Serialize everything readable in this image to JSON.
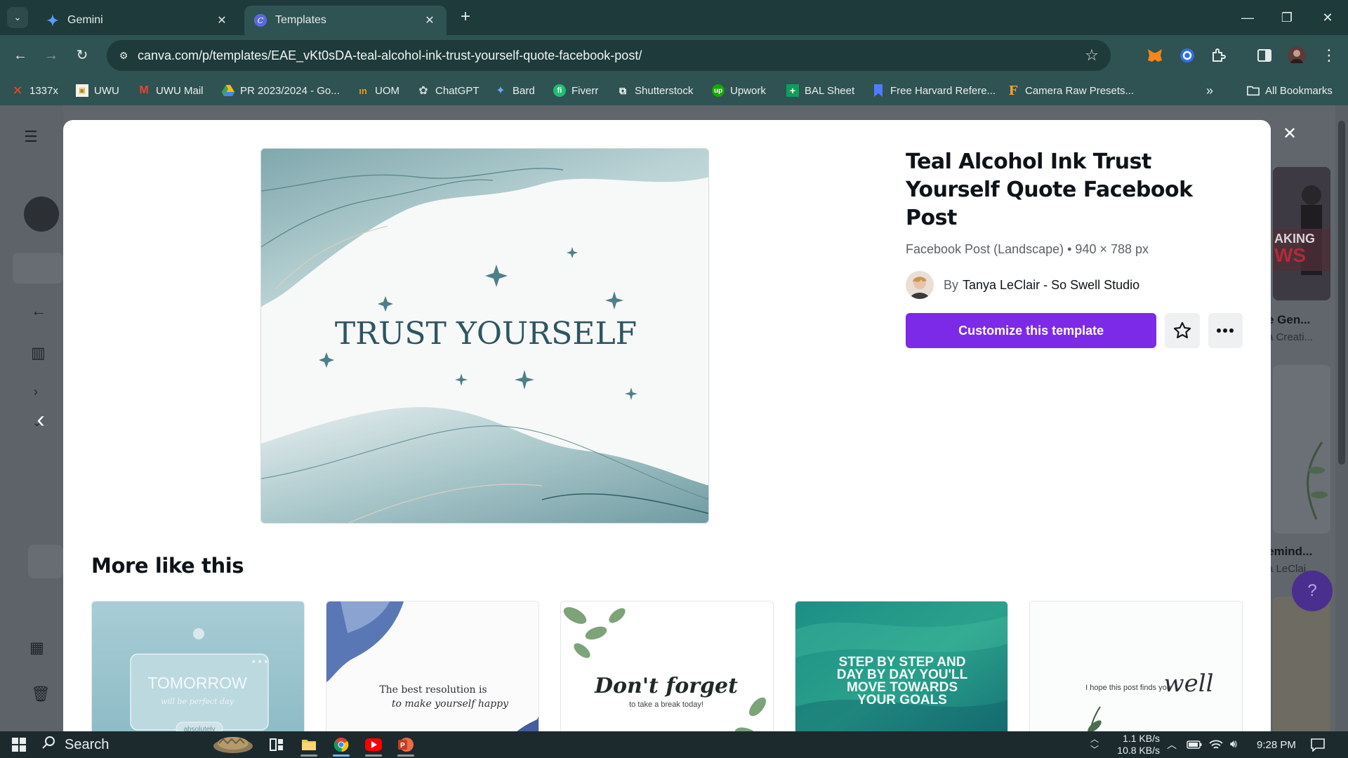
{
  "browser": {
    "tabs": [
      {
        "label": "Gemini",
        "icon": "gemini-sparkle-icon"
      },
      {
        "label": "Templates",
        "icon": "canva-logo-icon"
      }
    ],
    "url": "canva.com/p/templates/EAE_vKt0sDA-teal-alcohol-ink-trust-yourself-quote-facebook-post/",
    "bookmarks": [
      {
        "label": "1337x",
        "icon": "x-logo-icon",
        "color": "#e8492b"
      },
      {
        "label": "UWU",
        "icon": "uwu-crest-icon",
        "color": "#f1c40f"
      },
      {
        "label": "UWU Mail",
        "icon": "gmail-icon",
        "color": "#ea4335"
      },
      {
        "label": "PR 2023/2024 - Go...",
        "icon": "google-drive-icon",
        "color": "#34a853"
      },
      {
        "label": "UOM",
        "icon": "uom-logo-icon",
        "color": "#f39c12"
      },
      {
        "label": "ChatGPT",
        "icon": "chatgpt-icon",
        "color": "#c9d6d4"
      },
      {
        "label": "Bard",
        "icon": "bard-sparkle-icon",
        "color": "#6ea8fe"
      },
      {
        "label": "Fiverr",
        "icon": "fiverr-icon",
        "color": "#1dbf73"
      },
      {
        "label": "Shutterstock",
        "icon": "shutterstock-icon",
        "color": "#ffffff"
      },
      {
        "label": "Upwork",
        "icon": "upwork-icon",
        "color": "#14a800"
      },
      {
        "label": "BAL Sheet",
        "icon": "sheets-icon",
        "color": "#0f9d58"
      },
      {
        "label": "Free Harvard Refere...",
        "icon": "bookmark-icon",
        "color": "#4f7cff"
      },
      {
        "label": "Camera Raw Presets...",
        "icon": "f-logo-icon",
        "color": "#f5a623"
      }
    ],
    "all_bookmarks": "All Bookmarks"
  },
  "template": {
    "title": "Teal Alcohol Ink Trust Yourself Quote Facebook Post",
    "meta": "Facebook Post (Landscape) • 940 × 788 px",
    "by": "By",
    "author": "Tanya LeClair - So Swell Studio",
    "cta": "Customize this template",
    "preview_text": "TRUST YOURSELF"
  },
  "more": {
    "title": "More like this",
    "cards": [
      {
        "line1": "TOMORROW",
        "line2": "will be perfect day",
        "line3": "absolutely"
      },
      {
        "line1": "The best resolution is",
        "line2": "to make yourself happy"
      },
      {
        "line1": "Don't forget",
        "line2": "to take a break today!"
      },
      {
        "line1": "STEP BY STEP AND DAY BY DAY YOU'LL MOVE TOWARDS YOUR GOALS"
      },
      {
        "line1": "I hope this post finds you",
        "line2": "well"
      }
    ]
  },
  "background_page": {
    "items": [
      {
        "text": "e Gen..."
      },
      {
        "text": "a Creati..."
      },
      {
        "text": "emind..."
      },
      {
        "text": "a LeClai..."
      },
      {
        "text": "AKING"
      },
      {
        "text": "WS"
      }
    ]
  },
  "taskbar": {
    "search": "Search",
    "net_up": "1.1 KB/s",
    "net_down": "10.8 KB/s",
    "time": "9:28 PM"
  },
  "colors": {
    "accent": "#7d2ae8",
    "chrome": "#2f5252",
    "tabstrip": "#1e3a3a"
  }
}
